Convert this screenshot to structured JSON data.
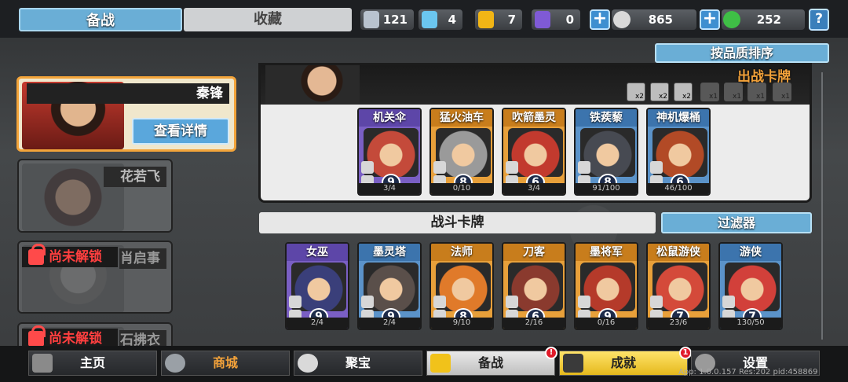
{
  "tabs": {
    "active": "备战",
    "inactive": "收藏"
  },
  "resources": [
    {
      "name": "silver-shield",
      "value": "121",
      "color": "#b9c3cf"
    },
    {
      "name": "crystal-shield",
      "value": "4",
      "color": "#6bc6ef"
    },
    {
      "name": "gold-shield",
      "value": "7",
      "color": "#f1b515"
    },
    {
      "name": "purple-shield",
      "value": "0",
      "color": "#7f5ad6"
    }
  ],
  "currency": {
    "coins": "865",
    "gems": "252"
  },
  "help_label": "?",
  "sort_button": "按品质排序",
  "heroes": [
    {
      "name": "秦锋",
      "detail_button": "查看详情"
    },
    {
      "name": "花若飞"
    },
    {
      "name": "肖启事",
      "locked": "尚未解锁"
    },
    {
      "name": "石拂衣",
      "locked": "尚未解锁"
    }
  ],
  "deck": {
    "title": "出战卡牌",
    "slot_labels": [
      "x2",
      "x2",
      "x2",
      "x1",
      "x1",
      "x1",
      "x1"
    ],
    "cards": [
      {
        "name": "机关伞",
        "cost": "9",
        "count": "3/4",
        "tier": "purple",
        "art": "#c44a3a"
      },
      {
        "name": "猛火油车",
        "cost": "8",
        "count": "0/10",
        "tier": "orange",
        "art": "#9a9a9a"
      },
      {
        "name": "吹箭墨灵",
        "cost": "6",
        "count": "3/4",
        "tier": "orange",
        "art": "#c23a2e"
      },
      {
        "name": "铁蒺藜",
        "cost": "8",
        "count": "91/100",
        "tier": "blue",
        "art": "#474a52"
      },
      {
        "name": "神机爆桶",
        "cost": "6",
        "count": "46/100",
        "tier": "blue",
        "art": "#b24a26"
      }
    ]
  },
  "battle_cards_label": "战斗卡牌",
  "filter_button": "过滤器",
  "battle_cards": [
    {
      "name": "女巫",
      "cost": "9",
      "count": "2/4",
      "tier": "purple",
      "art": "#3a3f7a"
    },
    {
      "name": "墨灵塔",
      "cost": "9",
      "count": "2/4",
      "tier": "blue",
      "art": "#5a4f4a"
    },
    {
      "name": "法师",
      "cost": "8",
      "count": "9/10",
      "tier": "orange",
      "art": "#e07a2a"
    },
    {
      "name": "刀客",
      "cost": "6",
      "count": "2/16",
      "tier": "orange",
      "art": "#8a3a2e"
    },
    {
      "name": "墨将军",
      "cost": "9",
      "count": "0/16",
      "tier": "orange",
      "art": "#b53a2a"
    },
    {
      "name": "松鼠游侠",
      "cost": "7",
      "count": "23/6",
      "tier": "orange",
      "art": "#d44a3a"
    },
    {
      "name": "游侠",
      "cost": "7",
      "count": "130/50",
      "tier": "blue",
      "art": "#d2403a"
    }
  ],
  "bottom_nav": [
    {
      "label": "主页",
      "state": "normal",
      "icon": "home-icon"
    },
    {
      "label": "商城",
      "state": "normal",
      "icon": "shop-icon",
      "color": "#f3a23a"
    },
    {
      "label": "聚宝",
      "state": "normal",
      "icon": "treasure-icon"
    },
    {
      "label": "备战",
      "state": "active",
      "icon": "deck-icon",
      "badge": "!"
    },
    {
      "label": "成就",
      "state": "highlight",
      "icon": "achievement-icon",
      "badge": "1"
    },
    {
      "label": "设置",
      "state": "normal",
      "icon": "gear-icon"
    }
  ],
  "version_text": "App: 1.0.0.157 Res:202 pid:458869"
}
